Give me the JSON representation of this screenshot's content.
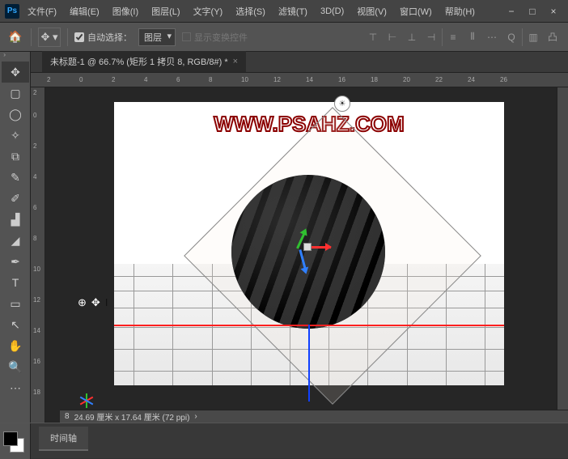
{
  "titlebar": {
    "logo": "Ps"
  },
  "menu": [
    "文件(F)",
    "编辑(E)",
    "图像(I)",
    "图层(L)",
    "文字(Y)",
    "选择(S)",
    "滤镜(T)",
    "3D(D)",
    "视图(V)",
    "窗口(W)",
    "帮助(H)"
  ],
  "options": {
    "auto_select_label": "自动选择：",
    "dropdown": "图层",
    "transform_label": "显示变换控件"
  },
  "doc_tab": {
    "title": "未标题-1 @ 66.7% (矩形 1 拷贝 8, RGB/8#) *"
  },
  "ruler_h": [
    "2",
    "0",
    "2",
    "4",
    "6",
    "8",
    "10",
    "12",
    "14",
    "16",
    "18",
    "20",
    "22",
    "24",
    "26"
  ],
  "ruler_v": [
    "2",
    "0",
    "2",
    "4",
    "6",
    "8",
    "10",
    "12",
    "14",
    "16",
    "18"
  ],
  "canvas": {
    "watermark": "WWW.PSAHZ.COM"
  },
  "status": {
    "index": "8",
    "dims": "24.69 厘米 x 17.64 厘米 (72 ppi)",
    "arrow": "›"
  },
  "bottom": {
    "timeline": "时间轴"
  }
}
